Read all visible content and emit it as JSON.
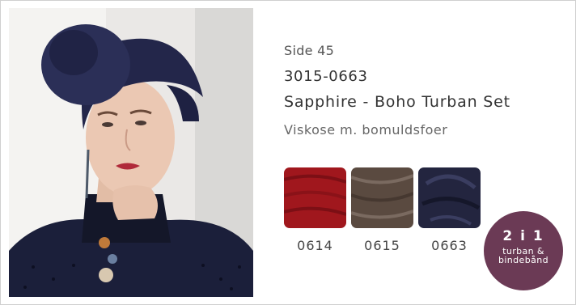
{
  "product": {
    "page_ref": "Side 45",
    "sku": "3015-0663",
    "title": "Sapphire - Boho Turban Set",
    "material": "Viskose m. bomuldsfoer"
  },
  "swatches": [
    {
      "code": "0614",
      "color": "#a0171d"
    },
    {
      "code": "0615",
      "color": "#5a4a40"
    },
    {
      "code": "0663",
      "color": "#23253f"
    }
  ],
  "badge": {
    "main": "2 i 1",
    "line1": "turban &",
    "line2": "bindebånd",
    "color": "#6b3a55"
  }
}
